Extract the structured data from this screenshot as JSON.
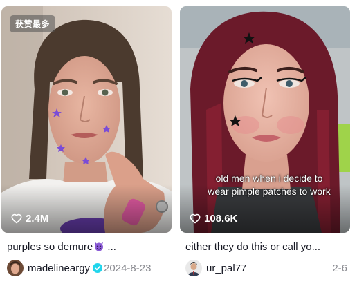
{
  "cards": [
    {
      "badge": "获赞最多",
      "likes": "2.4M",
      "description": "purples so demure",
      "description_suffix": " ...",
      "username": "madelineargy",
      "date": "2024-8-23",
      "verified": true
    },
    {
      "overlay_caption": "old men when i decide to wear pimple patches to work",
      "likes": "108.6K",
      "description": "either they do this or call yo...",
      "username": "ur_pal77",
      "date": "2-6",
      "verified": false
    }
  ],
  "colors": {
    "text": "#161823",
    "muted": "#8a8b91",
    "verified": "#20d5ec",
    "star_purple": "#7a4cd6"
  },
  "icons": {
    "likes": "heart-outline-icon",
    "verified": "verified-check-icon",
    "emoji": "smiling-devil-emoji"
  }
}
